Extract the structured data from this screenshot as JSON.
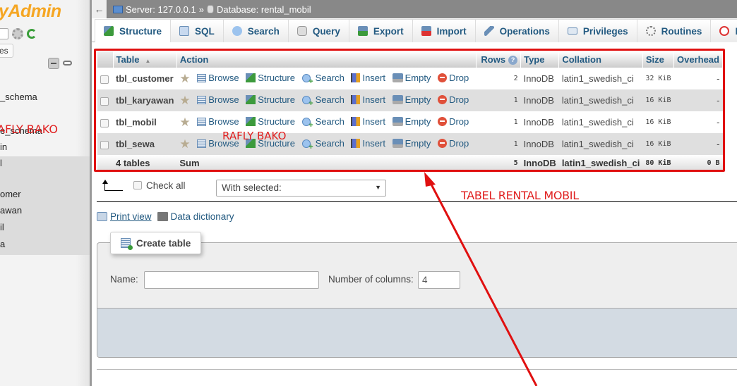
{
  "sidebar": {
    "logo": "yAdmin",
    "button_label": "es",
    "tree": [
      {
        "label": "_schema"
      },
      {
        "label": "e_schema"
      },
      {
        "label": "in"
      },
      {
        "label": "l"
      },
      {
        "label": "omer"
      },
      {
        "label": "awan"
      },
      {
        "label": "il"
      },
      {
        "label": "a"
      }
    ],
    "overlay_text": "AFLY BAKO"
  },
  "topbar": {
    "back": "←",
    "server": "Server: 127.0.0.1",
    "sep": "»",
    "database": "Database: rental_mobil"
  },
  "tabs": [
    {
      "label": "Structure",
      "icon": "structure-icon",
      "active": true
    },
    {
      "label": "SQL",
      "icon": "sql-icon"
    },
    {
      "label": "Search",
      "icon": "search-icon"
    },
    {
      "label": "Query",
      "icon": "query-icon"
    },
    {
      "label": "Export",
      "icon": "export-icon"
    },
    {
      "label": "Import",
      "icon": "import-icon"
    },
    {
      "label": "Operations",
      "icon": "wrench-icon"
    },
    {
      "label": "Privileges",
      "icon": "privileges-icon"
    },
    {
      "label": "Routines",
      "icon": "routines-icon"
    },
    {
      "label": "Ev",
      "icon": "events-icon"
    }
  ],
  "table": {
    "headers": {
      "table": "Table",
      "action": "Action",
      "rows": "Rows",
      "type": "Type",
      "collation": "Collation",
      "size": "Size",
      "overhead": "Overhead"
    },
    "actions": {
      "browse": "Browse",
      "structure": "Structure",
      "search": "Search",
      "insert": "Insert",
      "empty": "Empty",
      "drop": "Drop"
    },
    "rows": [
      {
        "name": "tbl_customer",
        "rows": "2",
        "type": "InnoDB",
        "collation": "latin1_swedish_ci",
        "size": "32 KiB",
        "overhead": "-"
      },
      {
        "name": "tbl_karyawan",
        "rows": "1",
        "type": "InnoDB",
        "collation": "latin1_swedish_ci",
        "size": "16 KiB",
        "overhead": "-"
      },
      {
        "name": "tbl_mobil",
        "rows": "1",
        "type": "InnoDB",
        "collation": "latin1_swedish_ci",
        "size": "16 KiB",
        "overhead": "-"
      },
      {
        "name": "tbl_sewa",
        "rows": "1",
        "type": "InnoDB",
        "collation": "latin1_swedish_ci",
        "size": "16 KiB",
        "overhead": "-"
      }
    ],
    "footer": {
      "count": "4 tables",
      "sum": "Sum",
      "rows": "5",
      "type": "InnoDB",
      "collation": "latin1_swedish_ci",
      "size": "80 KiB",
      "overhead": "0 B"
    }
  },
  "overlay_text": "RAFLY BAKO",
  "annotation": "TABEL RENTAL MOBIL",
  "bulk": {
    "check_all": "Check all",
    "with_selected": "With selected:"
  },
  "links": {
    "print_view": "Print view",
    "data_dictionary": "Data dictionary"
  },
  "create_table": {
    "legend": "Create table",
    "name_label": "Name:",
    "name_value": "",
    "columns_label": "Number of columns:",
    "columns_value": "4"
  },
  "colors": {
    "accent_red": "#e01010",
    "link_blue": "#235a81",
    "logo_orange": "#f5a623"
  }
}
